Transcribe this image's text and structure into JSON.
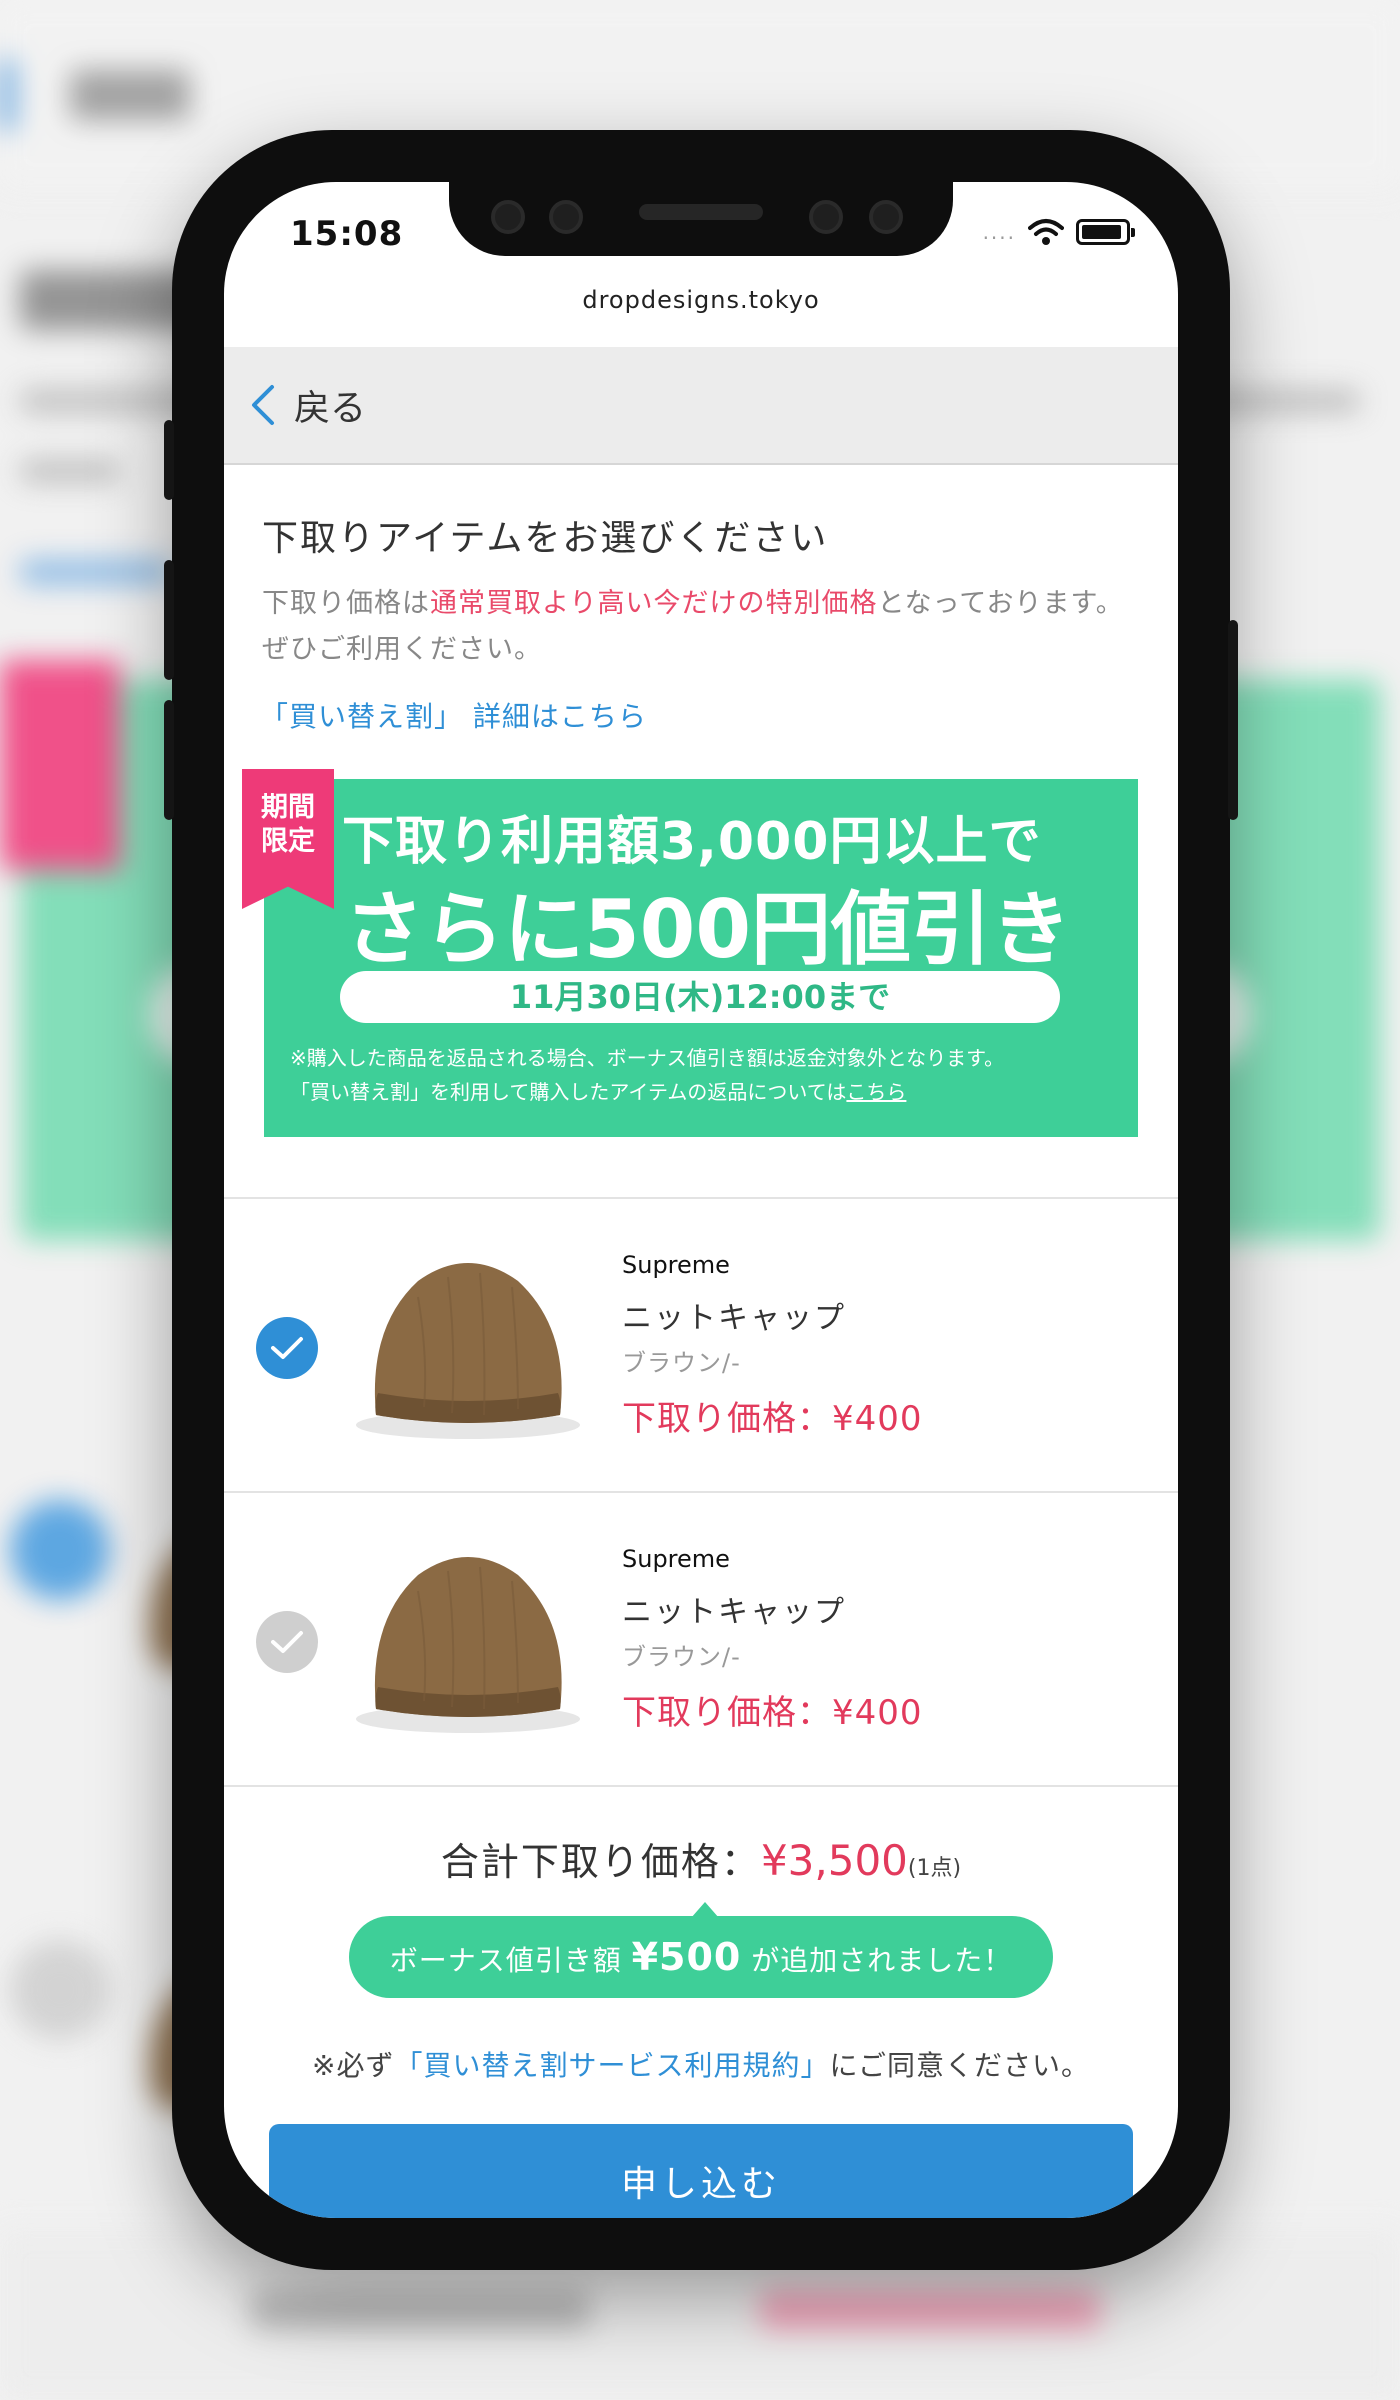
{
  "status": {
    "time": "15:08",
    "signal": "....",
    "icons": [
      "wifi-icon",
      "battery-icon"
    ]
  },
  "browser": {
    "url": "dropdesigns.tokyo"
  },
  "nav": {
    "back_label": "戻る"
  },
  "intro": {
    "title": "下取りアイテムをお選びください",
    "desc_pre": "下取り価格は",
    "desc_em": "通常買取より高い今だけの特別価格",
    "desc_post": "となっております。ぜひご利用ください。",
    "detail_link": "「買い替え割」 詳細はこちら"
  },
  "promo": {
    "ribbon_1": "期間",
    "ribbon_2": "限定",
    "line1": "下取り利用額3,000円以上で",
    "line2": "さらに500円値引き",
    "deadline": "11月30日(木)12:00まで",
    "note1": "※購入した商品を返品される場合、ボーナス値引き額は返金対象外となります。",
    "note2_pre": "「買い替え割」を利用して購入したアイテムの返品については",
    "note2_link": "こちら"
  },
  "items": [
    {
      "brand": "Supreme",
      "name": "ニットキャップ",
      "color": "ブラウン/-",
      "price": "下取り価格：¥400",
      "selected": true
    },
    {
      "brand": "Supreme",
      "name": "ニットキャップ",
      "color": "ブラウン/-",
      "price": "下取り価格：¥400",
      "selected": false
    }
  ],
  "total": {
    "label": "合計下取り価格：",
    "value": "¥3,500",
    "count": "(1点)"
  },
  "bonus": {
    "pre": "ボーナス値引き額 ",
    "amount": "¥500",
    "post": " が追加されました！"
  },
  "terms": {
    "pre": "※必ず",
    "link": "「買い替え割サービス利用規約」",
    "post": "にご同意ください。"
  },
  "submit_label": "申し込む",
  "colors": {
    "accent_blue": "#2f8fd6",
    "promo_green": "#3ecf98",
    "price_red": "#e23a5c",
    "ribbon_pink": "#ee3a78"
  }
}
